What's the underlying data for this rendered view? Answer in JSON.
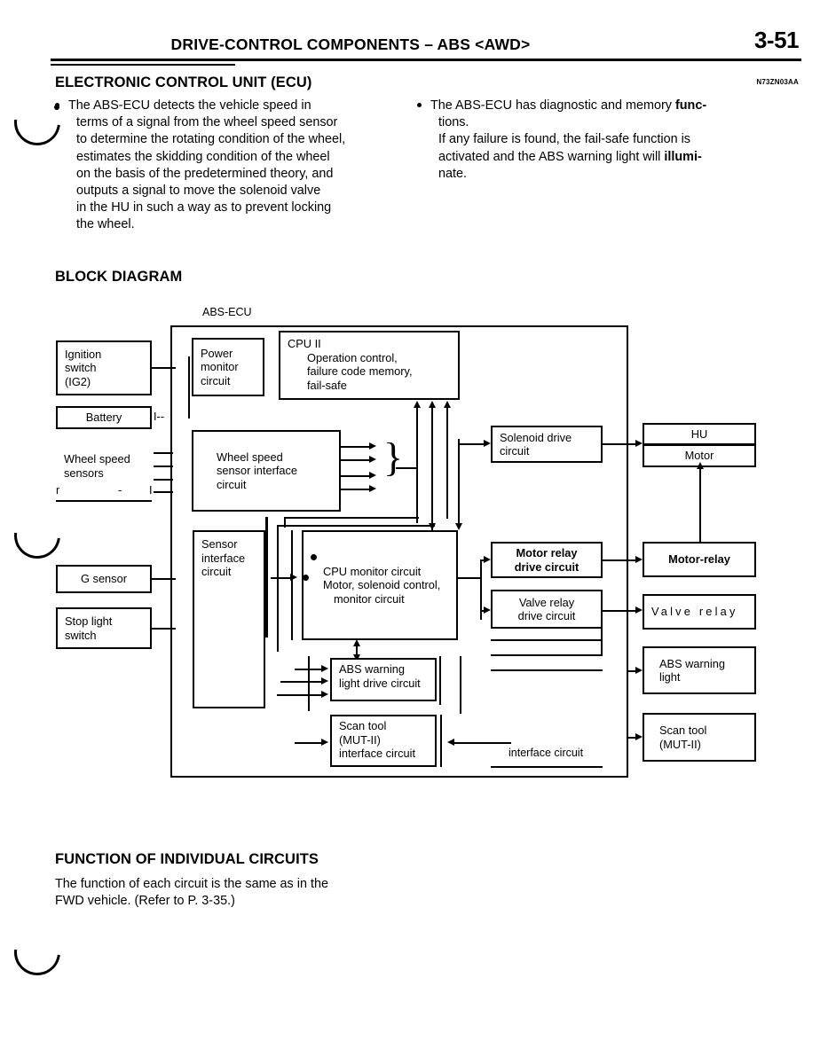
{
  "header": {
    "title": "DRIVE-CONTROL  COMPONENTS  – ABS <AWD>",
    "page_number": "3-51"
  },
  "sections": {
    "ecu_heading": "ELECTRONIC CONTROL UNIT (ECU)",
    "ecu_code": "N73ZN03AA",
    "block_diagram_heading": "BLOCK  DIAGRAM",
    "function_heading": "FUNCTION OF INDIVIDUAL CIRCUITS",
    "function_body_line1": "The function of each circuit is the same as in the",
    "function_body_line2": "FWD vehicle. (Refer to P. 3-35.)"
  },
  "bullets": {
    "left": {
      "lines": [
        "The ABS-ECU detects the vehicle speed in",
        "terms of a signal from the wheel speed sensor",
        "to determine the rotating condition of the wheel,",
        "estimates the skidding condition of the wheel",
        "on the basis of the predetermined theory, and",
        "outputs a signal to move the solenoid valve",
        "in the HU in such a way as to prevent locking",
        "the wheel."
      ]
    },
    "right": {
      "line1_normal": "The ABS-ECU has diagnostic and memory ",
      "line1_bold": "func-",
      "line2": "tions.",
      "line3": "If any failure is found, the fail-safe function is",
      "line4_normal": "activated and the ABS warning light will ",
      "line4_bold": "illumi-",
      "line5": "nate."
    }
  },
  "diagram": {
    "ecu_frame_label": "ABS-ECU",
    "inputs": {
      "ignition_switch": [
        "Ignition",
        "switch",
        "(IG2)"
      ],
      "battery": "Battery",
      "wheel_speed_sensors": [
        "Wheel  speed",
        "sensors"
      ],
      "wheel_speed_fragment_left": "r",
      "wheel_speed_fragment_mid": "-",
      "g_sensor": "G sensor",
      "stop_light_switch": [
        "Stop light",
        "switch"
      ]
    },
    "ecu_internal": {
      "power_monitor": [
        "Power",
        "monitor",
        "circuit"
      ],
      "cpu2_title": "CPU II",
      "cpu2_lines": [
        "Operation control,",
        "failure code memory,",
        "fail-safe"
      ],
      "wheel_speed_interface": [
        "Wheel speed",
        "sensor interface",
        "circuit"
      ],
      "sensor_interface": [
        "Sensor",
        "interface",
        "circuit"
      ],
      "monitor_box": {
        "item1": "CPU monitor circuit",
        "item2_line1": "Motor, solenoid control,",
        "item2_line2": "monitor  circuit"
      },
      "solenoid_drive": [
        "Solenoid drive",
        "circuit"
      ],
      "motor_relay_drive": [
        "Motor relay",
        "drive circuit"
      ],
      "valve_relay_drive": [
        "Valve  relay",
        "drive  circuit"
      ],
      "abs_warning_light_drive": [
        "ABS warning",
        "light drive circuit"
      ],
      "scan_tool_interface": [
        "Scan tool",
        "(MUT-II)",
        "interface circuit"
      ],
      "interface_circuit_label": "interface  circuit"
    },
    "outputs": {
      "hu": "HU",
      "motor": "Motor",
      "motor_relay": "Motor-relay",
      "valve_relay": "Valve relay",
      "abs_warning_light": [
        "ABS warning",
        "light"
      ],
      "scan_tool": [
        "Scan tool",
        "(MUT-II)"
      ]
    }
  }
}
